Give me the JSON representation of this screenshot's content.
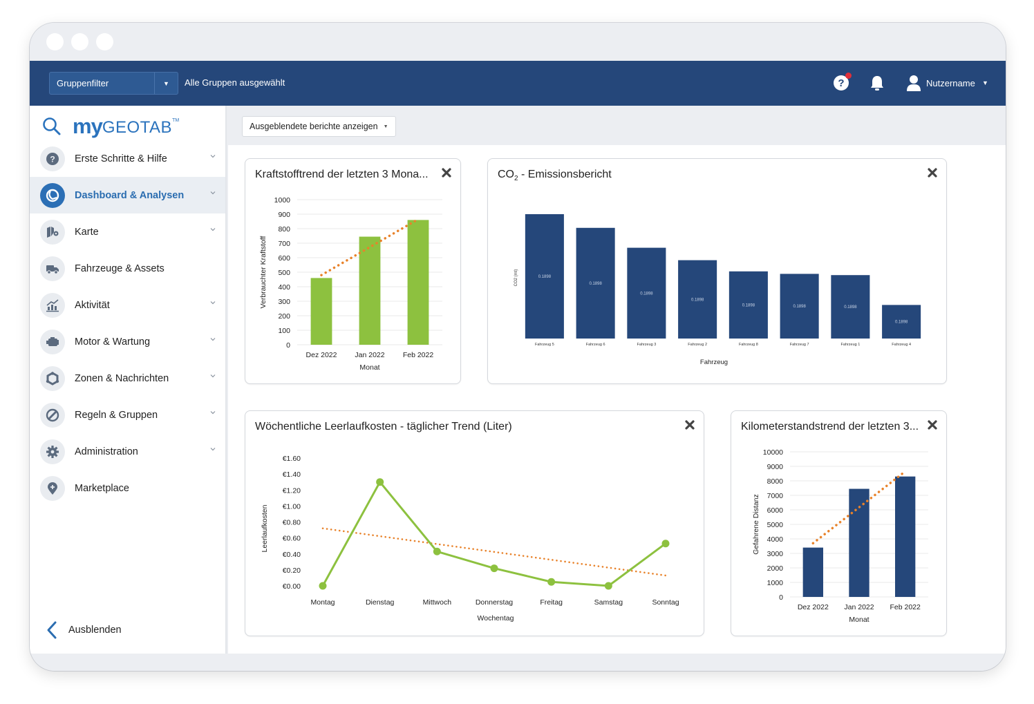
{
  "window": {
    "controls": [
      "dot",
      "dot",
      "dot"
    ]
  },
  "topbar": {
    "group_filter_label": "Gruppenfilter",
    "group_status": "Alle Gruppen ausgewählt",
    "help_label": "?",
    "username": "Nutzername",
    "colors": {
      "bar": "#25477a",
      "notification_dot": "#e0303a"
    }
  },
  "brand": {
    "my": "my",
    "name": "GEOTAB",
    "tm": "TM"
  },
  "sidebar": {
    "items": [
      {
        "label": "Erste Schritte & Hilfe",
        "icon": "help-circle-icon",
        "has_chevron": true,
        "active": false
      },
      {
        "label": "Dashboard & Analysen",
        "icon": "dashboard-icon",
        "has_chevron": true,
        "active": true
      },
      {
        "label": "Karte",
        "icon": "map-icon",
        "has_chevron": true,
        "active": false
      },
      {
        "label": "Fahrzeuge & Assets",
        "icon": "truck-icon",
        "has_chevron": false,
        "active": false
      },
      {
        "label": "Aktivität",
        "icon": "activity-chart-icon",
        "has_chevron": true,
        "active": false
      },
      {
        "label": "Motor & Wartung",
        "icon": "engine-icon",
        "has_chevron": true,
        "active": false
      },
      {
        "label": "Zonen & Nachrichten",
        "icon": "zones-icon",
        "has_chevron": true,
        "active": false
      },
      {
        "label": "Regeln & Gruppen",
        "icon": "rules-icon",
        "has_chevron": true,
        "active": false
      },
      {
        "label": "Administration",
        "icon": "gear-icon",
        "has_chevron": true,
        "active": false
      },
      {
        "label": "Marketplace",
        "icon": "marketplace-icon",
        "has_chevron": false,
        "active": false
      }
    ],
    "collapse_label": "Ausblenden"
  },
  "toolbar": {
    "hidden_reports_label": "Ausgeblendete berichte anzeigen"
  },
  "cards": {
    "fuel": {
      "title": "Kraftstofftrend der letzten 3 Mona..."
    },
    "co2": {
      "title_prefix": "CO",
      "title_sub": "2",
      "title_suffix": " - Emissionsbericht"
    },
    "idle": {
      "title": "Wöchentliche Leerlaufkosten - täglicher Trend (Liter)"
    },
    "mileage": {
      "title": "Kilometerstandstrend der letzten 3..."
    }
  },
  "chart_data": [
    {
      "id": "fuel",
      "type": "bar",
      "title": "Kraftstofftrend der letzten 3 Mona...",
      "xlabel": "Monat",
      "ylabel": "Verbrauchter Kraftstoff",
      "categories": [
        "Dez 2022",
        "Jan 2022",
        "Feb 2022"
      ],
      "values": [
        460,
        745,
        860
      ],
      "trendline": {
        "style": "dotted",
        "color": "#e8822a",
        "start": 480,
        "end": 865
      },
      "ylim": [
        0,
        1000
      ],
      "yticks": [
        0,
        100,
        200,
        300,
        400,
        500,
        600,
        700,
        800,
        900,
        1000
      ],
      "grid": true,
      "bar_color": "#8dc13f"
    },
    {
      "id": "co2",
      "type": "bar",
      "title": "CO2 - Emissionsbericht",
      "xlabel": "Fahrzeug",
      "ylabel": "CO2 (mt)",
      "categories": [
        "Fahrzeug 5",
        "Fahrzeug 6",
        "Fahrzeug 3",
        "Fahrzeug 2",
        "Fahrzeug 8",
        "Fahrzeug 7",
        "Fahrzeug 1",
        "Fahrzeug 4"
      ],
      "values": [
        1.0,
        0.89,
        0.73,
        0.63,
        0.54,
        0.52,
        0.51,
        0.27
      ],
      "value_note": "relative bar heights (no y-axis ticks shown)",
      "data_labels": [
        "0.1898",
        "0.1898",
        "0.1898",
        "0.1898",
        "0.1898",
        "0.1898",
        "0.1898",
        "0.1898"
      ],
      "grid": false,
      "bar_color": "#25477a"
    },
    {
      "id": "idle",
      "type": "line",
      "title": "Wöchentliche Leerlaufkosten - täglicher Trend (Liter)",
      "xlabel": "Wochentag",
      "ylabel": "Leerlaufkosten",
      "categories": [
        "Montag",
        "Dienstag",
        "Mittwoch",
        "Donnerstag",
        "Freitag",
        "Samstag",
        "Sonntag"
      ],
      "values": [
        0.0,
        1.3,
        0.43,
        0.22,
        0.05,
        0.0,
        0.53
      ],
      "trendline": {
        "style": "dotted",
        "color": "#e8822a",
        "start": 0.72,
        "end": 0.13
      },
      "ylim": [
        0,
        1.6
      ],
      "yticks": [
        "€0.00",
        "€0.20",
        "€0.40",
        "€0.60",
        "€0.80",
        "€1.00",
        "€1.20",
        "€1.40",
        "€1.60"
      ],
      "grid": false,
      "line_color": "#8dc13f"
    },
    {
      "id": "mileage",
      "type": "bar",
      "title": "Kilometerstandstrend der letzten 3...",
      "xlabel": "Monat",
      "ylabel": "Gefahrene Distanz",
      "categories": [
        "Dez 2022",
        "Jan 2022",
        "Feb 2022"
      ],
      "values": [
        3400,
        7450,
        8300
      ],
      "trendline": {
        "style": "dotted",
        "color": "#e8822a",
        "start": 3700,
        "end": 8650
      },
      "ylim": [
        0,
        10000
      ],
      "yticks": [
        0,
        1000,
        2000,
        3000,
        4000,
        5000,
        6000,
        7000,
        8000,
        9000,
        10000
      ],
      "grid": true,
      "bar_color": "#25477a"
    }
  ]
}
